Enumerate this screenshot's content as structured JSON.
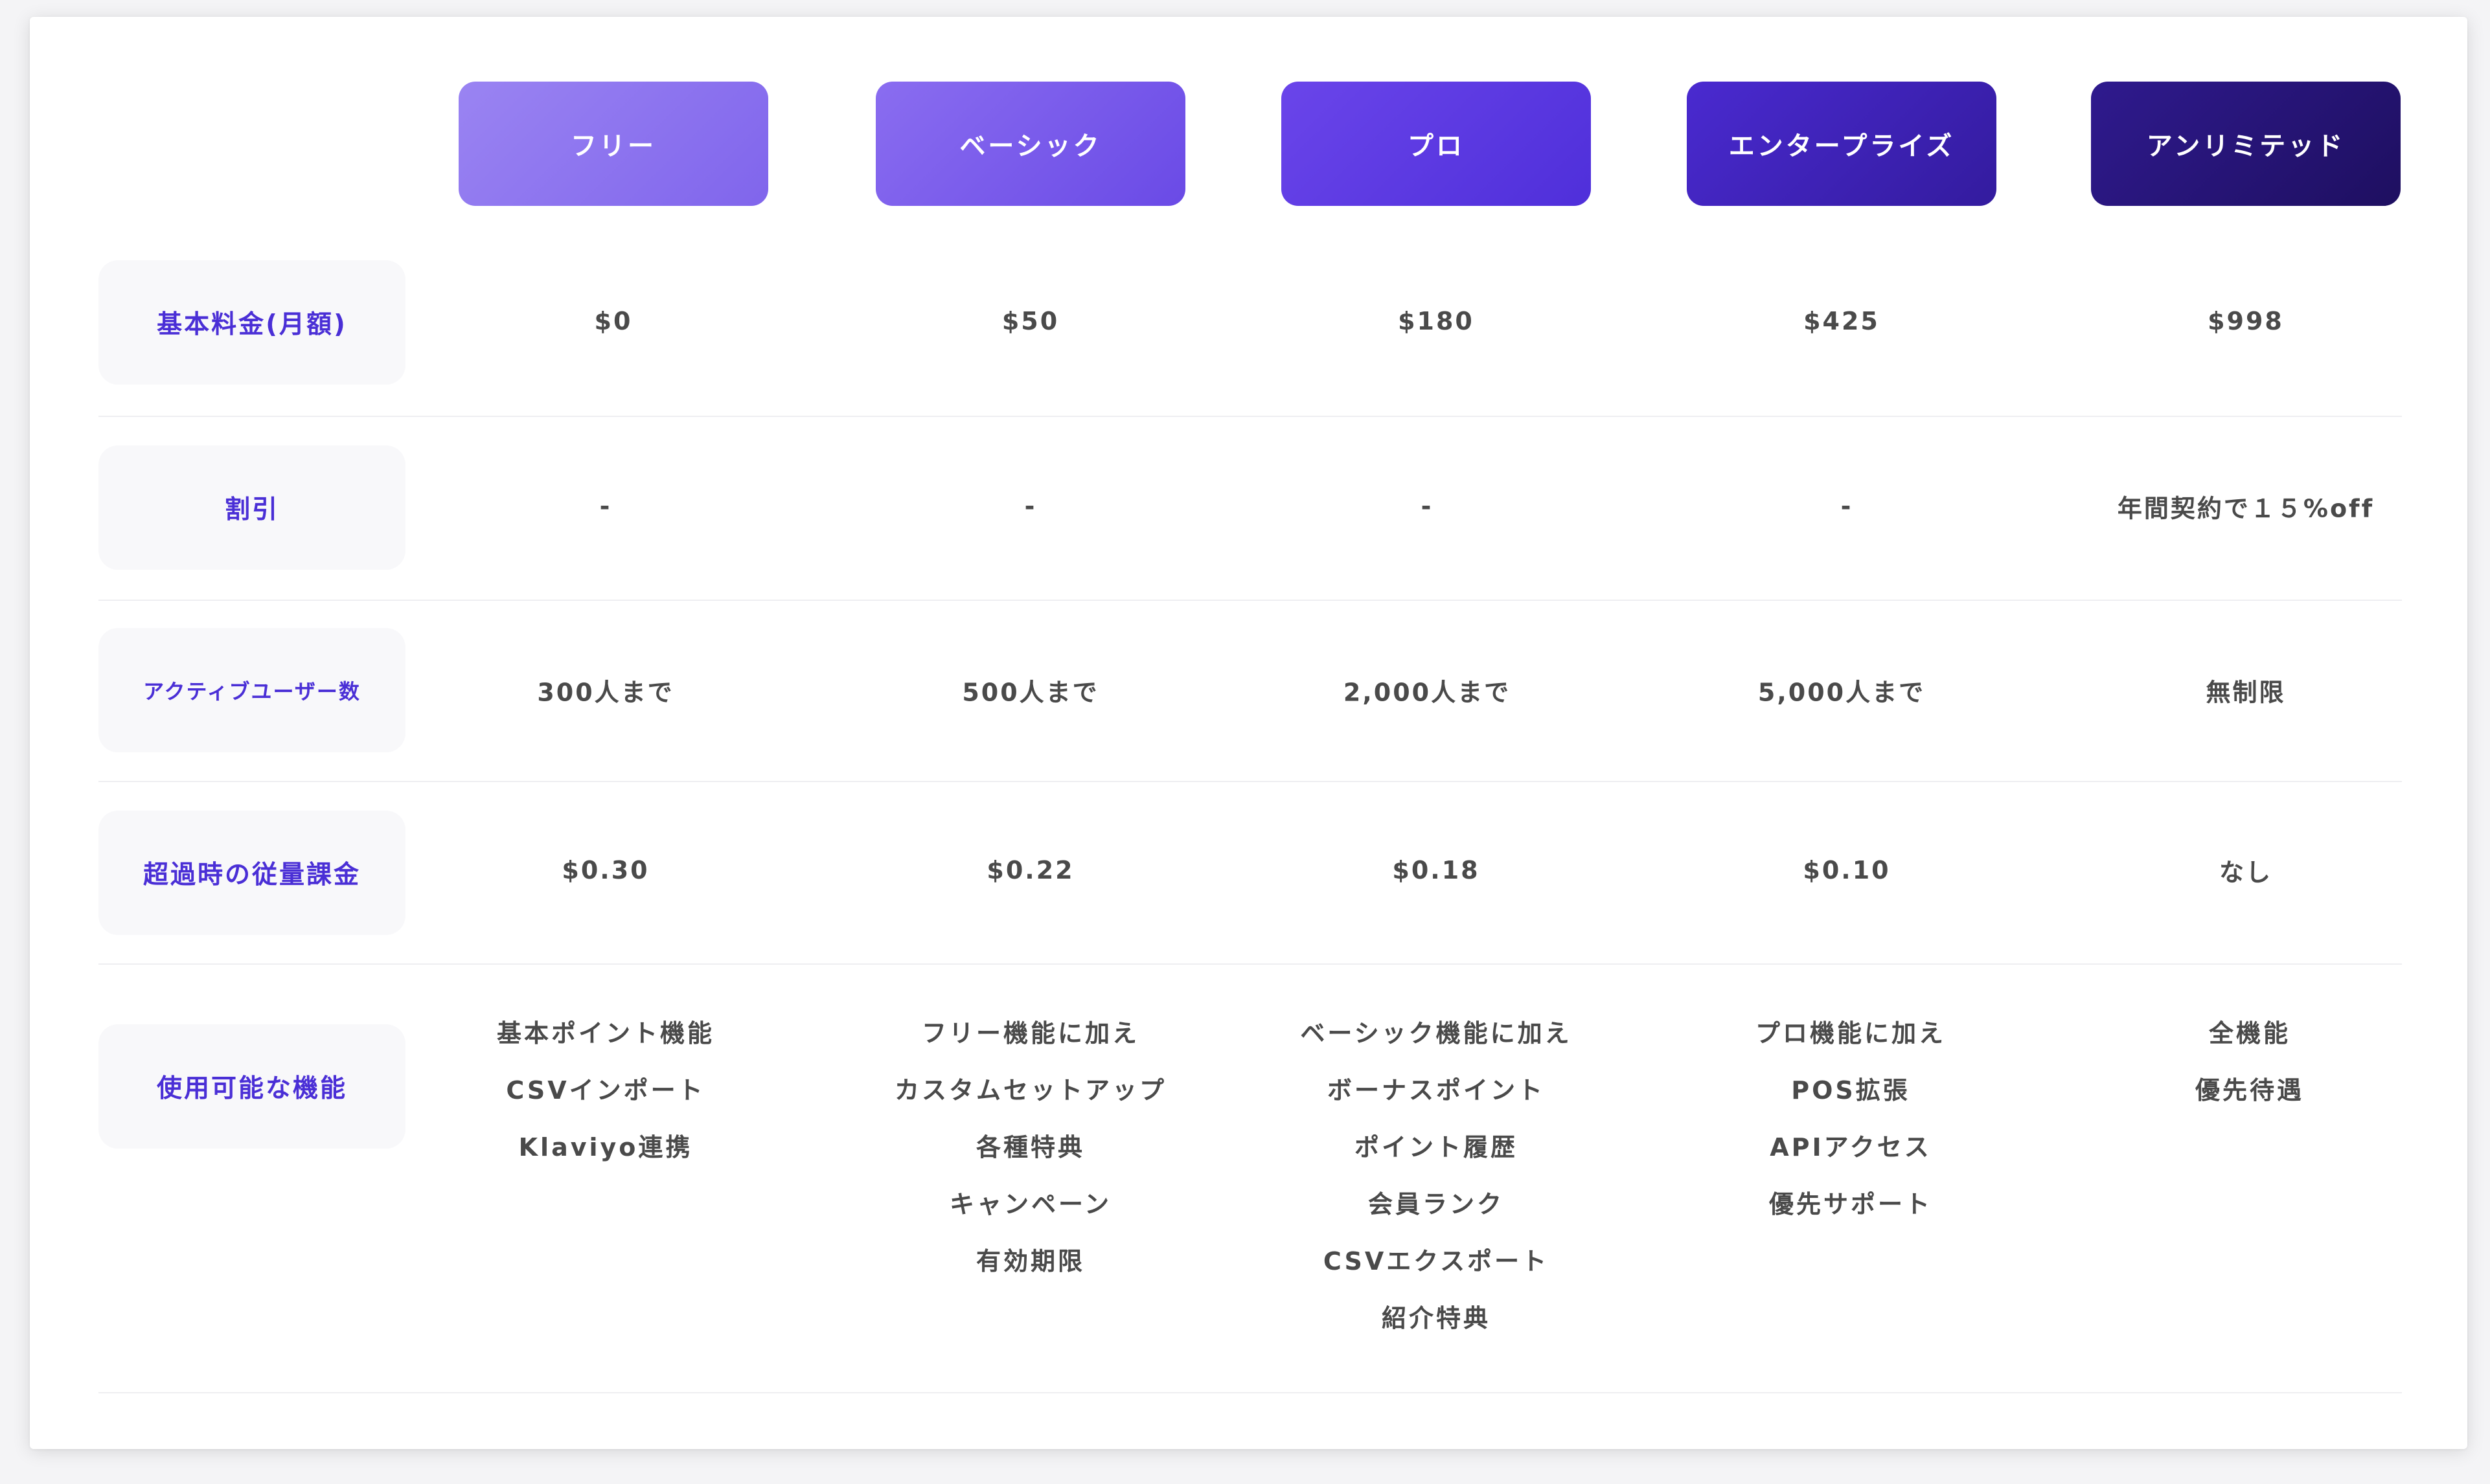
{
  "plans": [
    {
      "name": "フリー",
      "color_from": "#9a84f2",
      "color_to": "#8065ec"
    },
    {
      "name": "ベーシック",
      "color_from": "#8a6df0",
      "color_to": "#6a4ae6"
    },
    {
      "name": "プロ",
      "color_from": "#6a45ea",
      "color_to": "#4f2fda"
    },
    {
      "name": "エンタープライズ",
      "color_from": "#4a2ad0",
      "color_to": "#331b9e"
    },
    {
      "name": "アンリミテッド",
      "color_from": "#2f1a8e",
      "color_to": "#1e0f60"
    }
  ],
  "rows": {
    "price": {
      "label": "基本料金(月額)",
      "values": [
        "$0",
        "$50",
        "$180",
        "$425",
        "$998"
      ]
    },
    "discount": {
      "label": "割引",
      "values": [
        "-",
        "-",
        "-",
        "-",
        "年間契約で１５%off"
      ]
    },
    "users": {
      "label": "アクティブユーザー数",
      "values": [
        "300人まで",
        "500人まで",
        "2,000人まで",
        "5,000人まで",
        "無制限"
      ]
    },
    "overage": {
      "label": "超過時の従量課金",
      "values": [
        "$0.30",
        "$0.22",
        "$0.18",
        "$0.10",
        "なし"
      ]
    },
    "features": {
      "label": "使用可能な機能",
      "lists": [
        [
          "基本ポイント機能",
          "CSVインポート",
          "Klaviyo連携"
        ],
        [
          "フリー機能に加え",
          "カスタムセットアップ",
          "各種特典",
          "キャンペーン",
          "有効期限"
        ],
        [
          "ベーシック機能に加え",
          "ボーナスポイント",
          "ポイント履歴",
          "会員ランク",
          "CSVエクスポート",
          "紹介特典"
        ],
        [
          "プロ機能に加え",
          "POS拡張",
          "APIアクセス",
          "優先サポート"
        ],
        [
          "全機能",
          "優先待遇"
        ]
      ]
    }
  },
  "colors": {
    "label_text": "#4a2fd6",
    "label_bg": "#f8f8fa",
    "value_text": "#4a4a4a"
  }
}
